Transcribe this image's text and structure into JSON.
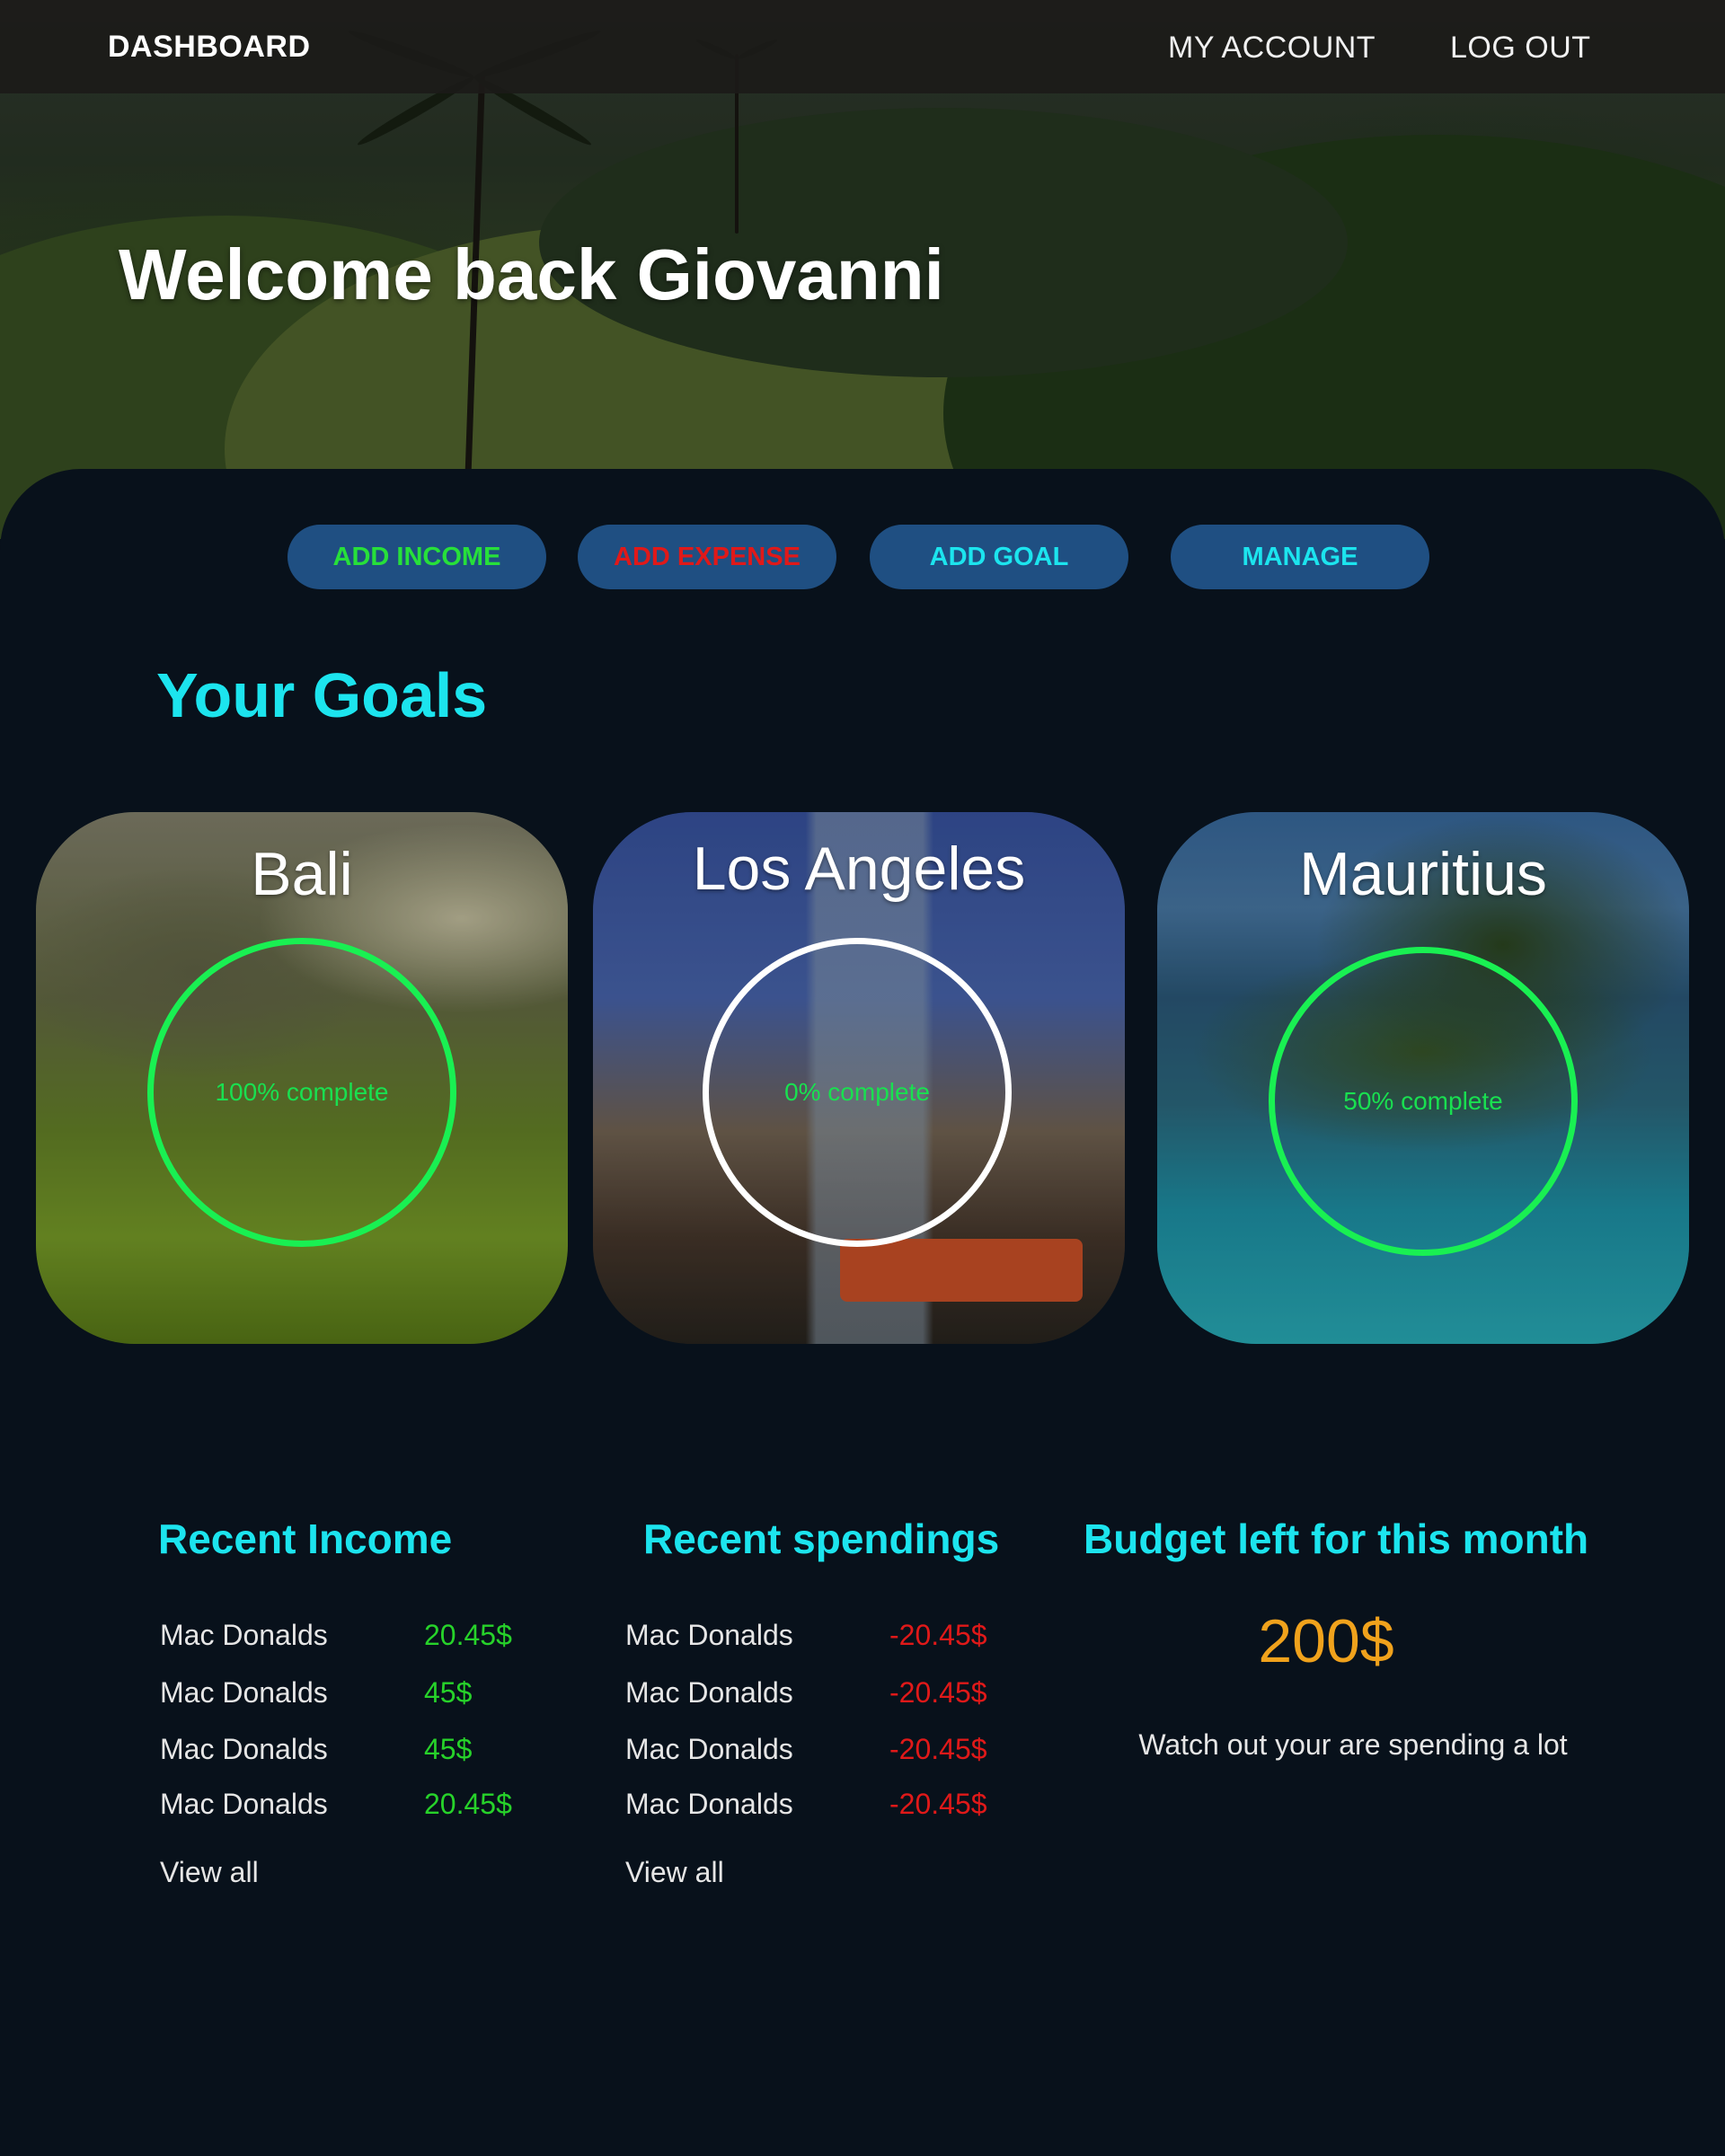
{
  "nav": {
    "brand": "DASHBOARD",
    "my_account": "MY ACCOUNT",
    "log_out": "LOG OUT"
  },
  "hero": {
    "welcome": "Welcome back Giovanni"
  },
  "actions": {
    "add_income": "ADD INCOME",
    "add_expense": "ADD EXPENSE",
    "add_goal": "ADD GOAL",
    "manage": "MANAGE"
  },
  "goals": {
    "title": "Your Goals",
    "items": [
      {
        "name": "Bali",
        "progress_label": "100% complete",
        "progress": 1.0
      },
      {
        "name": "Los Angeles",
        "progress_label": "0% complete",
        "progress": 0.0
      },
      {
        "name": "Mauritius",
        "progress_label": "50% complete",
        "progress": 0.5
      }
    ]
  },
  "income": {
    "title": "Recent Income",
    "rows": [
      {
        "label": "Mac Donalds",
        "amount": "20.45$"
      },
      {
        "label": "Mac Donalds",
        "amount": "45$"
      },
      {
        "label": "Mac Donalds",
        "amount": "45$"
      },
      {
        "label": "Mac Donalds",
        "amount": "20.45$"
      }
    ],
    "view_all": "View all"
  },
  "spendings": {
    "title": "Recent spendings",
    "rows": [
      {
        "label": "Mac Donalds",
        "amount": "-20.45$"
      },
      {
        "label": "Mac Donalds",
        "amount": "-20.45$"
      },
      {
        "label": "Mac Donalds",
        "amount": "-20.45$"
      },
      {
        "label": "Mac Donalds",
        "amount": "-20.45$"
      }
    ],
    "view_all": "View all"
  },
  "budget": {
    "title": "Budget left for this month",
    "amount": "200$",
    "note": "Watch out your are spending a lot"
  },
  "colors": {
    "background": "#08111b",
    "accent_title": "#1ce4ee",
    "button_bg": "#1f4f82",
    "income_green": "#27d22a",
    "expense_red": "#e01919",
    "budget_orange": "#f0a21c",
    "ring_green": "#19f052"
  }
}
